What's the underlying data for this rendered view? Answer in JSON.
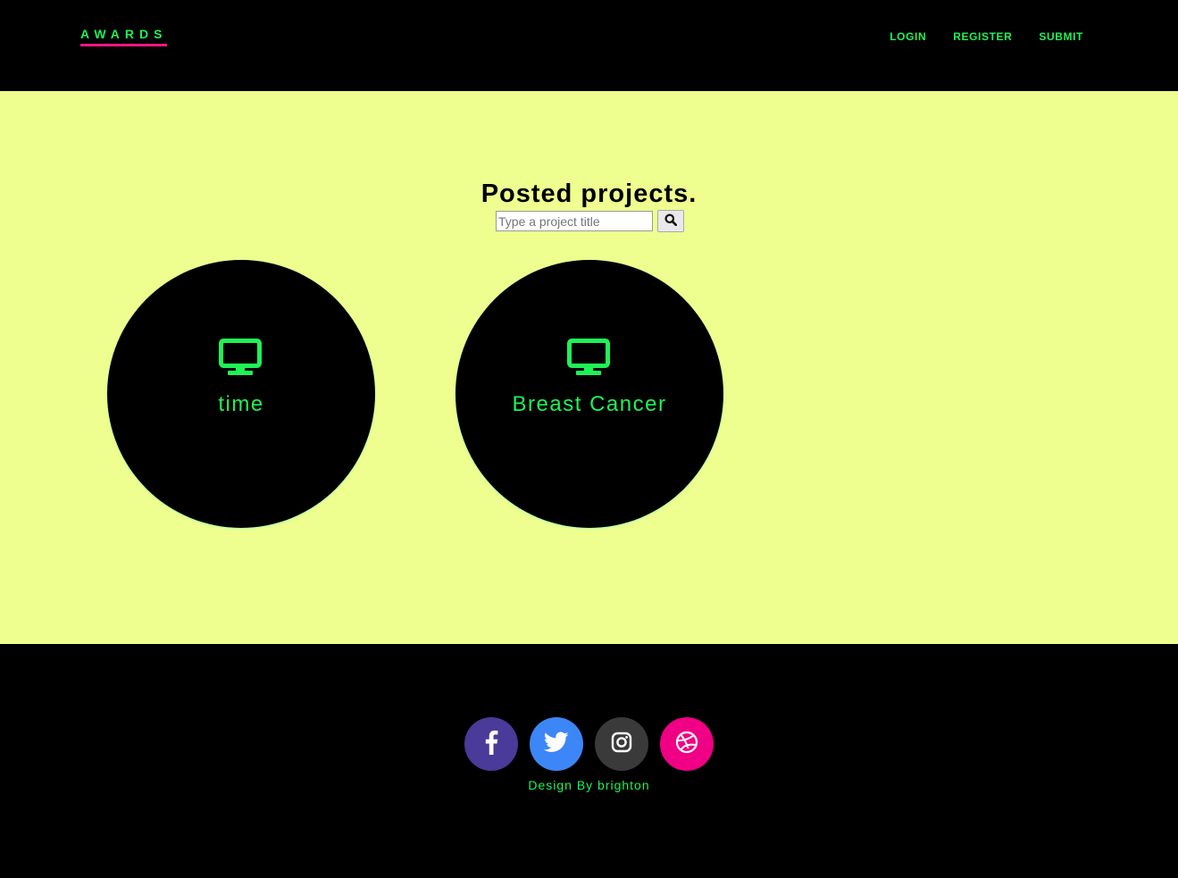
{
  "brand": {
    "name": "AWARDS",
    "color": "#1ff256",
    "underline_color": "#f2177e"
  },
  "nav": {
    "items": [
      {
        "label": "LOGIN"
      },
      {
        "label": "REGISTER"
      },
      {
        "label": "SUBMIT"
      }
    ]
  },
  "main": {
    "background": "#eeff8f",
    "title": "Posted projects.",
    "search": {
      "placeholder": "Type a project title",
      "value": "",
      "button_icon": "search-icon"
    },
    "projects": [
      {
        "icon": "desktop-icon",
        "title": "time"
      },
      {
        "icon": "desktop-icon",
        "title": "Breast Cancer"
      }
    ]
  },
  "footer": {
    "social": [
      {
        "name": "facebook-icon",
        "color": "#4a3a99"
      },
      {
        "name": "twitter-icon",
        "color": "#3d86f7"
      },
      {
        "name": "instagram-icon",
        "color": "#3a3a3a"
      },
      {
        "name": "dribbble-icon",
        "color": "#f00085"
      }
    ],
    "credit": "Design By brighton"
  }
}
